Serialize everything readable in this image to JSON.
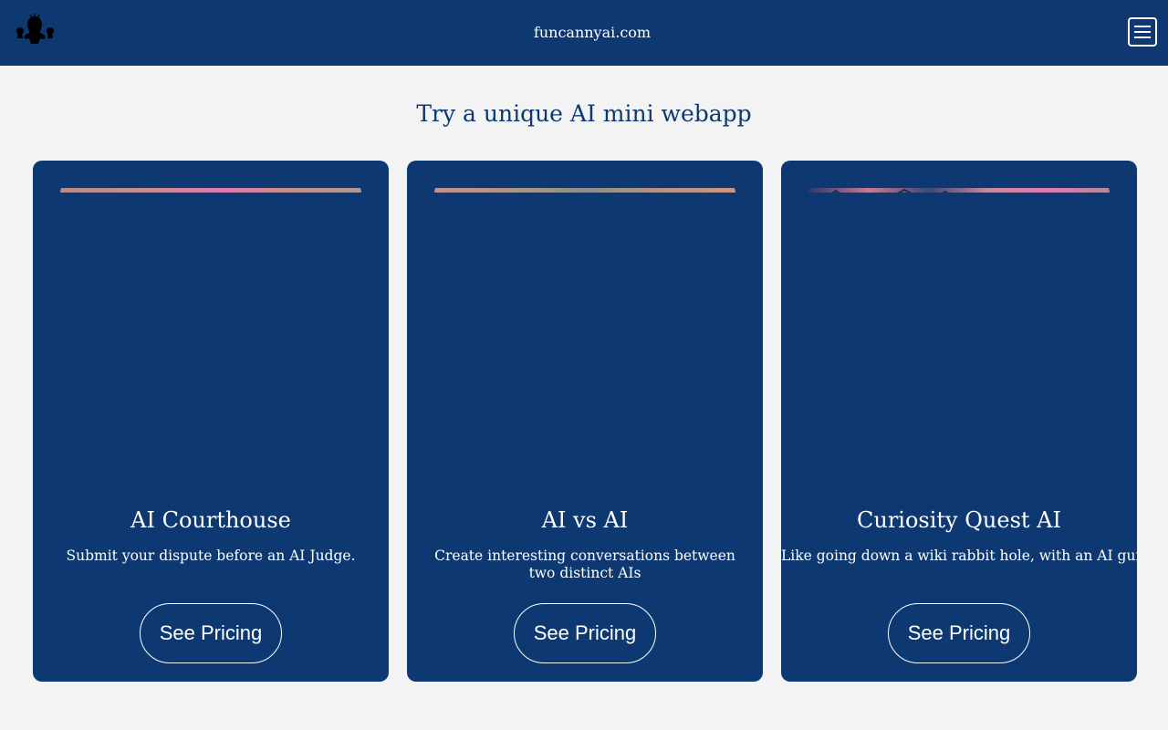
{
  "header": {
    "site_name": "funcannyai.com",
    "logo_icon": "silhouette-logo-icon",
    "menu_icon": "hamburger-menu-icon"
  },
  "main": {
    "heading": "Try a unique AI mini webapp",
    "cards": [
      {
        "title": "AI Courthouse",
        "description": "Submit your dispute before an AI Judge.",
        "button_label": "See Pricing"
      },
      {
        "title": "AI vs AI",
        "description": "Create interesting conversations between two distinct AIs",
        "button_label": "See Pricing"
      },
      {
        "title": "Curiosity Quest AI",
        "description": "Like going down a wiki rabbit hole, with an AI guide.",
        "button_label": "See Pricing"
      }
    ]
  },
  "colors": {
    "brand_navy": "#0d3871",
    "page_background": "#f3f3f3",
    "text_on_brand": "#ffffff"
  }
}
